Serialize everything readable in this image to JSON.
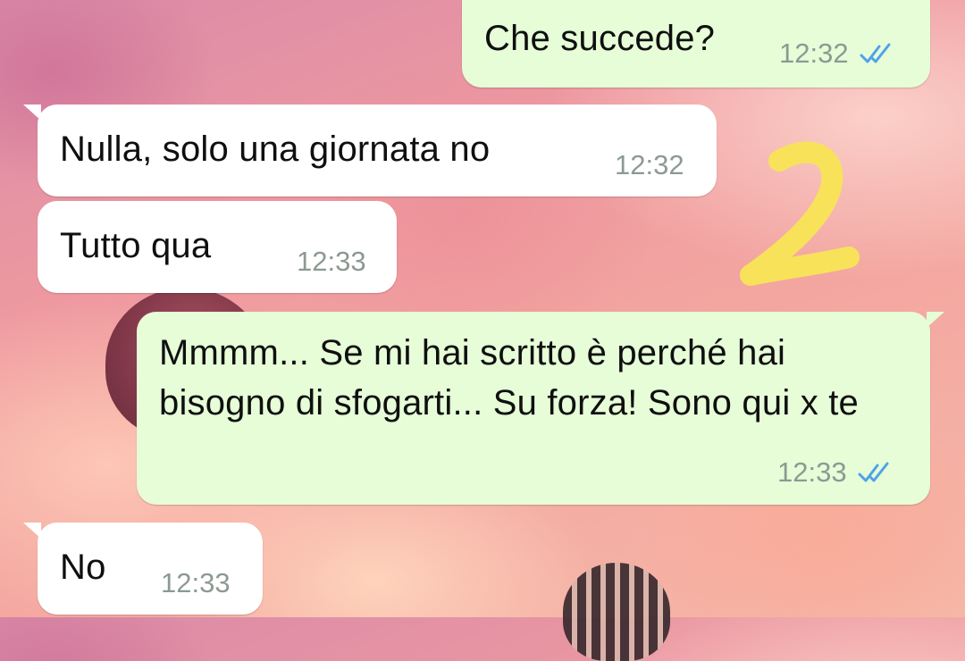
{
  "chat": {
    "messages": [
      {
        "direction": "out",
        "text": "Che succede?",
        "time": "12:32",
        "status": "read"
      },
      {
        "direction": "in",
        "text": "Nulla, solo una giornata no",
        "time": "12:32"
      },
      {
        "direction": "in",
        "text": "Tutto qua",
        "time": "12:33"
      },
      {
        "direction": "out",
        "text": "Mmmm... Se mi hai scritto è perché hai bisogno di sfogarti... Su forza! Sono qui x te",
        "time": "12:33",
        "status": "read"
      },
      {
        "direction": "in",
        "text": "No",
        "time": "12:33"
      }
    ]
  },
  "annotation": {
    "text": "2",
    "color": "#f8e25a"
  },
  "colors": {
    "outgoing_bubble": "#e6fdd8",
    "incoming_bubble": "#ffffff",
    "timestamp": "#8c9a92",
    "read_ticks": "#4fa3e8"
  },
  "icons": {
    "read_receipt": "double-check-icon"
  }
}
